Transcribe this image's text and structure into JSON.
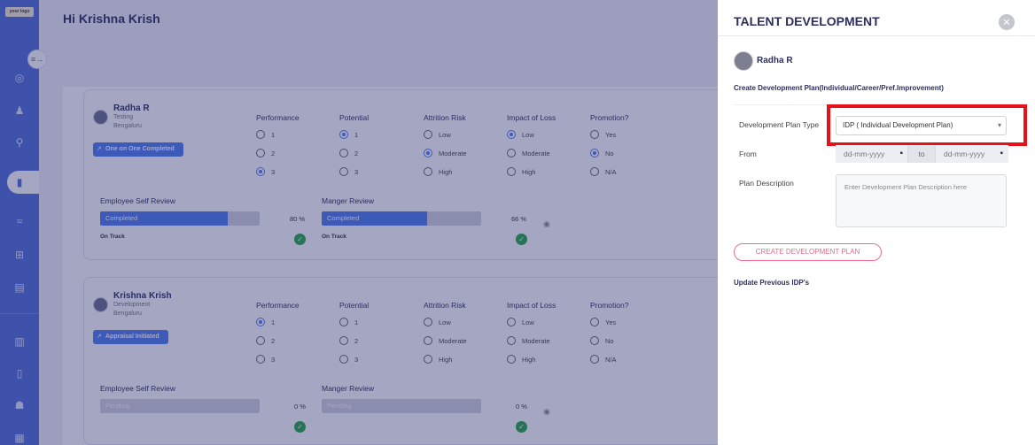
{
  "sidebar": {
    "logo": "your logo",
    "icons": [
      "target-icon",
      "team-icon",
      "person-tree-icon",
      "book-icon",
      "handshake-icon",
      "hierarchy-icon",
      "checklist-icon",
      "bar-chart-icon",
      "book-icon-2",
      "group-icon",
      "report-icon"
    ]
  },
  "header": {
    "greeting": "Hi Krishna Krish"
  },
  "columns": {
    "performance": "Performance",
    "potential": "Potential",
    "attrition": "Attrition Risk",
    "impact": "Impact of Loss",
    "promotion": "Promotion?"
  },
  "options": {
    "performance": [
      "1",
      "2",
      "3"
    ],
    "potential": [
      "1",
      "2",
      "3"
    ],
    "attrition": [
      "Low",
      "Moderate",
      "High"
    ],
    "impact": [
      "Low",
      "Moderate",
      "High"
    ],
    "promotion": [
      "Yes",
      "No",
      "N/A"
    ]
  },
  "employees": [
    {
      "name": "Radha R",
      "role": "Testing",
      "location": "Bengaluru",
      "status": "One on One Completed",
      "selected": {
        "performance": 2,
        "potential": 0,
        "attrition": 1,
        "impact": 0,
        "promotion": 1
      },
      "self_review": {
        "title": "Employee Self Review",
        "label": "Completed",
        "percent_text": "80 %",
        "progress": 0.8,
        "track": "On Track"
      },
      "manager_review": {
        "title": "Manger Review",
        "label": "Completed",
        "percent_text": "66 %",
        "progress": 0.66,
        "track": "On Track"
      }
    },
    {
      "name": "Krishna Krish",
      "role": "Development",
      "location": "Bengaluru",
      "status": "Appraisal Initiated",
      "selected": {
        "performance": 0,
        "potential": -1,
        "attrition": -1,
        "impact": -1,
        "promotion": -1
      },
      "self_review": {
        "title": "Employee Self Review",
        "label": "Pending",
        "percent_text": "0 %",
        "progress": 0,
        "track": ""
      },
      "manager_review": {
        "title": "Manger Review",
        "label": "Pending",
        "percent_text": "0 %",
        "progress": 0,
        "track": ""
      }
    }
  ],
  "panel": {
    "title": "TALENT DEVELOPMENT",
    "employee_name": "Radha R",
    "subtitle": "Create Development Plan(Individual/Career/Pref.Improvement)",
    "plan_type_label": "Development Plan Type",
    "plan_type_value": "IDP ( Individual Development Plan)",
    "from_label": "From",
    "from_placeholder": "dd-mm-yyyy",
    "to_label": "to",
    "to_placeholder": "dd-mm-yyyy",
    "description_label": "Plan Description",
    "description_placeholder": "Enter Development Plan Description here",
    "create_button": "CREATE DEVELOPMENT PLAN",
    "update_link": "Update Previous IDP's"
  },
  "colors": {
    "accent": "#4f7df0",
    "highlight": "#e8111a",
    "success": "#27a844",
    "pink": "#e26b8c"
  }
}
